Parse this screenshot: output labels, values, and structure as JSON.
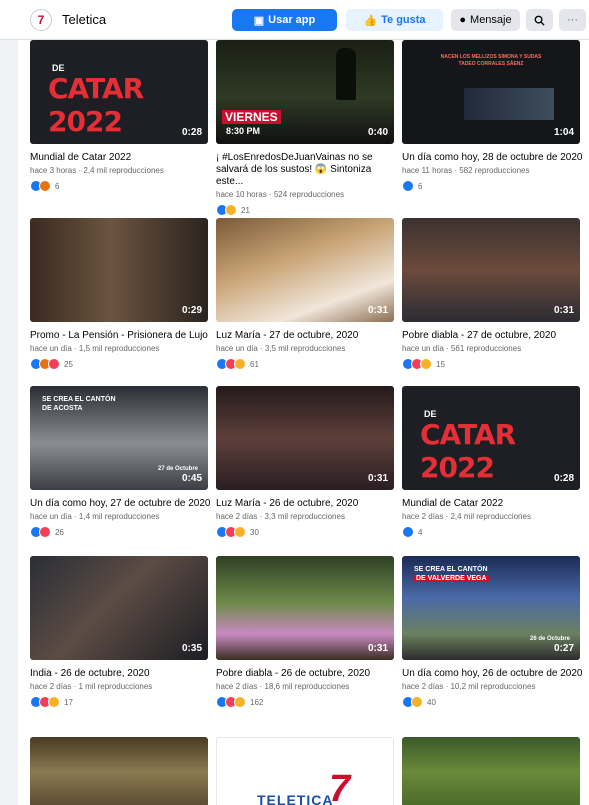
{
  "header": {
    "page_name": "Teletica",
    "logo_text": "7",
    "use_app_label": "Usar app",
    "like_label": "Te gusta",
    "message_label": "Mensaje",
    "more_label": "···"
  },
  "videos": [
    {
      "title": "Mundial de Catar 2022",
      "meta": "hace 3 horas · 2,4 mil reproducciones",
      "duration": "0:28",
      "reactions": [
        "like",
        "angry"
      ],
      "count": "6",
      "thumb_kind": "catar",
      "thumb_de": "DE",
      "thumb_text": "CATAR 2022"
    },
    {
      "title": "¡ #LosEnredosDeJuanVainas no se salvará de los sustos! 😱 Sintoniza este...",
      "meta": "hace 10 horas · 524 reproducciones",
      "duration": "0:40",
      "reactions": [
        "like",
        "haha"
      ],
      "count": "21",
      "thumb_kind": "night",
      "thumb_text": "VIERNES",
      "thumb_text2": "8:30 PM"
    },
    {
      "title": "Un día como hoy, 28 de octubre de 2020",
      "meta": "hace 11 horas · 582 reproducciones",
      "duration": "1:04",
      "reactions": [
        "like"
      ],
      "count": "6",
      "thumb_kind": "dark",
      "thumb_text": "NACEN LOS MELLIZOS SIMONA Y SUDAS TADEO CORRALES SÁENZ"
    },
    {
      "title": "Promo - La Pensión - Prisionera de Lujo",
      "meta": "hace un día · 1,5 mil reproducciones",
      "duration": "0:29",
      "reactions": [
        "like",
        "angry",
        "love"
      ],
      "count": "25",
      "thumb_kind": "room"
    },
    {
      "title": "Luz María - 27 de octubre, 2020",
      "meta": "hace un día · 3,5 mil reproducciones",
      "duration": "0:31",
      "reactions": [
        "like",
        "love",
        "wow"
      ],
      "count": "61",
      "thumb_kind": "bed"
    },
    {
      "title": "Pobre diabla - 27 de octubre, 2020",
      "meta": "hace un día · 561 reproducciones",
      "duration": "0:31",
      "reactions": [
        "like",
        "love",
        "wow"
      ],
      "count": "15",
      "thumb_kind": "man"
    },
    {
      "title": "Un día como hoy, 27 de octubre de 2020",
      "meta": "hace un día · 1,4 mil reproducciones",
      "duration": "0:45",
      "reactions": [
        "like",
        "love"
      ],
      "count": "26",
      "thumb_kind": "crowd",
      "thumb_text": "SE CREA EL CANTÓN",
      "thumb_text2": "DE ACOSTA",
      "thumb_text3": "27 de Octubre"
    },
    {
      "title": "Luz María - 26 de octubre, 2020",
      "meta": "hace 2 días · 3,3 mil reproducciones",
      "duration": "0:31",
      "reactions": [
        "like",
        "love",
        "wow"
      ],
      "count": "30",
      "thumb_kind": "hat"
    },
    {
      "title": "Mundial de Catar 2022",
      "meta": "hace 2 días · 2,4 mil reproducciones",
      "duration": "0:28",
      "reactions": [
        "like"
      ],
      "count": "4",
      "thumb_kind": "catar",
      "thumb_de": "DE",
      "thumb_text": "CATAR 2022"
    },
    {
      "title": "India - 26 de octubre, 2020",
      "meta": "hace 2 días · 1 mil reproducciones",
      "duration": "0:35",
      "reactions": [
        "like",
        "love",
        "wow"
      ],
      "count": "17",
      "thumb_kind": "phone"
    },
    {
      "title": "Pobre diabla - 26 de octubre, 2020",
      "meta": "hace 2 días · 18,6 mil reproducciones",
      "duration": "0:31",
      "reactions": [
        "like",
        "love",
        "haha"
      ],
      "count": "162",
      "thumb_kind": "woman"
    },
    {
      "title": "Un día como hoy, 26 de octubre de 2020",
      "meta": "hace 2 días · 10,2 mil reproducciones",
      "duration": "0:27",
      "reactions": [
        "like",
        "wow"
      ],
      "count": "40",
      "thumb_kind": "town",
      "thumb_text": "SE CREA EL CANTÓN",
      "thumb_text2": "DE VALVERDE VEGA",
      "thumb_text3": "26 de Octubre"
    }
  ],
  "bottom_row": [
    {
      "thumb_kind": "group"
    },
    {
      "thumb_kind": "logo",
      "thumb_text": "TELETICA",
      "thumb_text2": "7"
    },
    {
      "thumb_kind": "tree"
    }
  ],
  "colors": {
    "like": "#1877f2",
    "love": "#f33e58",
    "angry": "#e9710f",
    "haha": "#f7b125",
    "wow": "#f7b125",
    "catar_red": "#e62e36",
    "primary": "#1877f2"
  }
}
